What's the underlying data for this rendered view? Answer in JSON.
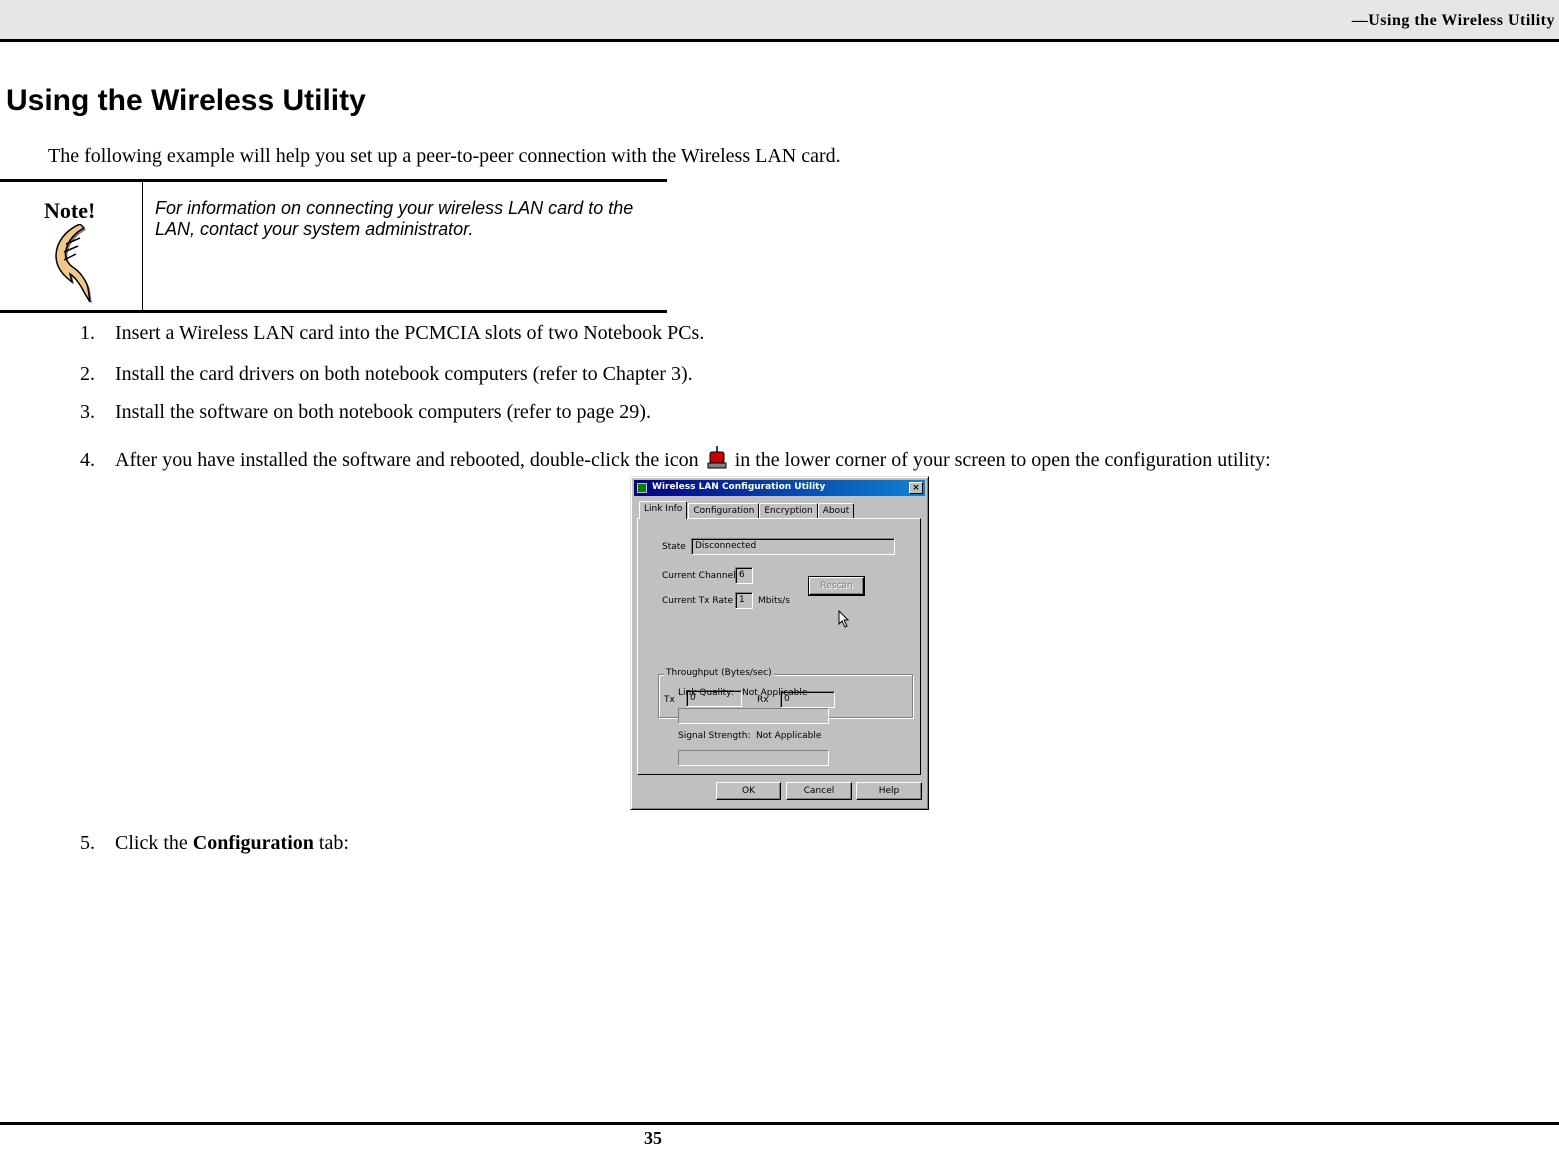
{
  "header": {
    "running_title": "—Using the Wireless Utility"
  },
  "title": "Using the Wireless Utility",
  "intro": "The following example will help you set up a peer-to-peer connection with the Wireless LAN card.",
  "note": {
    "label": "Note!",
    "icon": "pointing-hand-icon",
    "text": "For information on connecting your wireless LAN card to the LAN, contact your system administrator."
  },
  "steps": [
    {
      "num": "1.",
      "text": "Insert a Wireless LAN card into the PCMCIA slots of two Notebook PCs."
    },
    {
      "num": "2.",
      "text": "Install the card drivers on both notebook computers (refer to Chapter 3)."
    },
    {
      "num": "3.",
      "text": "Install the software on both notebook computers (refer to page 29)."
    },
    {
      "num": "4.",
      "text_before": "After you have installed the software and rebooted, double-click the icon",
      "icon": "wireless-tray-icon",
      "text_after": "in the lower corner of your screen to open the configuration utility:"
    },
    {
      "num": "5.",
      "text_before": "Click the",
      "bold": "Configuration",
      "text_after": "tab:"
    }
  ],
  "dialog": {
    "title": "Wireless LAN Configuration Utility",
    "close": "×",
    "tabs": [
      "Link Info",
      "Configuration",
      "Encryption",
      "About"
    ],
    "active_tab": "Link Info",
    "state_label": "State",
    "state_value": "Disconnected",
    "channel_label": "Current Channel",
    "channel_value": "6",
    "txrate_label": "Current Tx Rate",
    "txrate_value": "1",
    "txrate_unit": "Mbits/s",
    "rescan": "Rescan",
    "throughput_label": "Throughput (Bytes/sec)",
    "tx_label": "Tx",
    "tx_value": "0",
    "rx_label": "Rx",
    "rx_value": "0",
    "link_quality_label": "Link Quality:",
    "link_quality_value": "Not Applicable",
    "signal_label": "Signal Strength:",
    "signal_value": "Not Applicable",
    "ok": "OK",
    "cancel": "Cancel",
    "help": "Help"
  },
  "page_number": "35"
}
